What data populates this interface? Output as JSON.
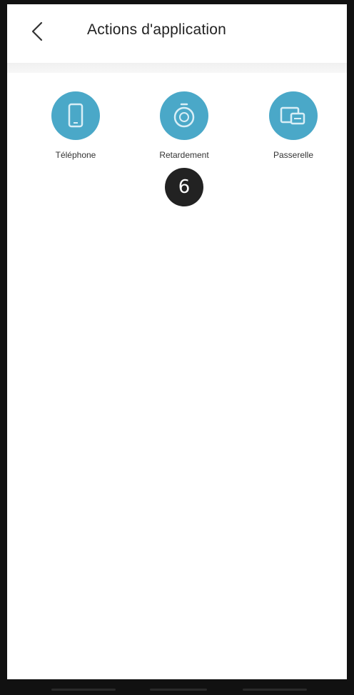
{
  "header": {
    "title": "Actions d'application",
    "back_icon": "chevron-left-icon"
  },
  "actions": [
    {
      "label": "Téléphone",
      "icon": "phone-icon",
      "color": "#4aa8c8"
    },
    {
      "label": "Retardement",
      "icon": "timer-icon",
      "color": "#4aa8c8"
    },
    {
      "label": "Passerelle",
      "icon": "gateway-icon",
      "color": "#4aa8c8"
    }
  ],
  "badge": {
    "value": "6"
  },
  "colors": {
    "accent": "#4aa8c8",
    "badge_bg": "#222222",
    "background": "#ffffff"
  }
}
